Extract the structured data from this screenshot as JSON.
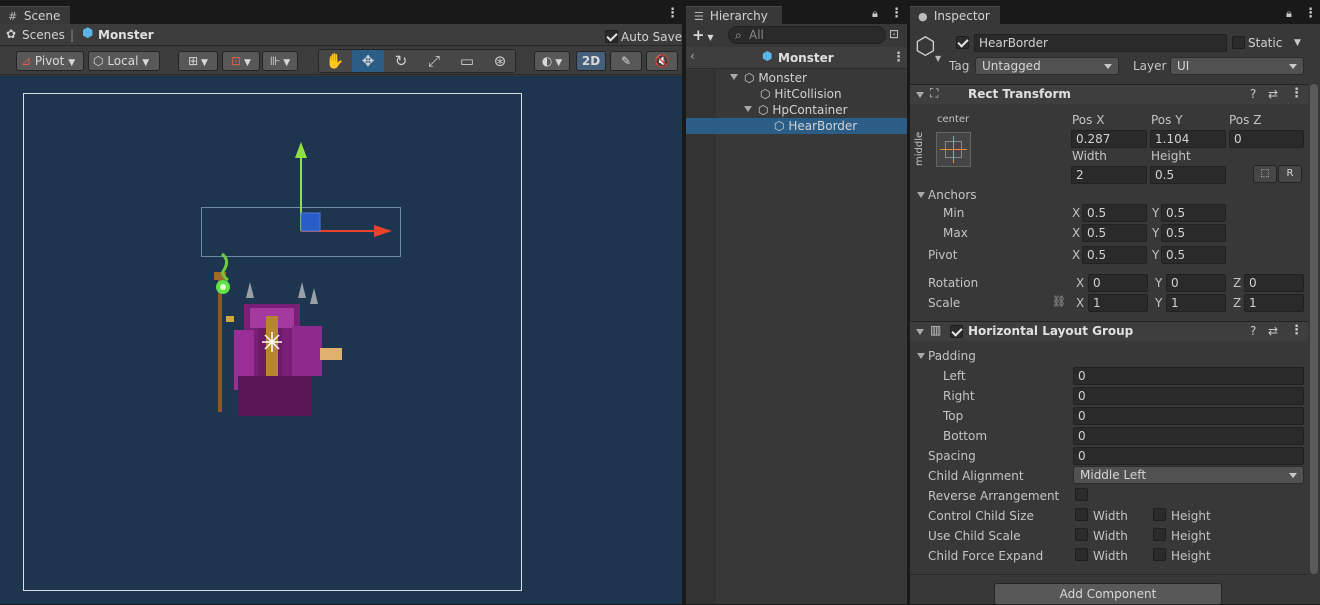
{
  "scene": {
    "tab_title": "Scene",
    "breadcrumb_root": "Scenes",
    "breadcrumb_current": "Monster",
    "auto_save_label": "Auto Save",
    "auto_save_checked": true,
    "pivot_label": "Pivot",
    "local_label": "Local",
    "mode_2d_label": "2D"
  },
  "hierarchy": {
    "tab_title": "Hierarchy",
    "search_placeholder": "All",
    "scene_root": "Monster",
    "items": [
      {
        "label": "Monster"
      },
      {
        "label": "HitCollision"
      },
      {
        "label": "HpContainer"
      },
      {
        "label": "HearBorder"
      }
    ]
  },
  "inspector": {
    "tab_title": "Inspector",
    "object_name": "HearBorder",
    "static_label": "Static",
    "tag_label": "Tag",
    "tag_value": "Untagged",
    "layer_label": "Layer",
    "layer_value": "UI",
    "rect_transform": {
      "title": "Rect Transform",
      "anchor_h": "center",
      "anchor_v": "middle",
      "pos_x_label": "Pos X",
      "pos_x": "0.287",
      "pos_y_label": "Pos Y",
      "pos_y": "1.104",
      "pos_z_label": "Pos Z",
      "pos_z": "0",
      "width_label": "Width",
      "width": "2",
      "height_label": "Height",
      "height": "0.5",
      "r_button": "R",
      "anchors_label": "Anchors",
      "min_label": "Min",
      "min_x": "0.5",
      "min_y": "0.5",
      "max_label": "Max",
      "max_x": "0.5",
      "max_y": "0.5",
      "pivot_label": "Pivot",
      "pivot_x": "0.5",
      "pivot_y": "0.5",
      "rotation_label": "Rotation",
      "rot_x": "0",
      "rot_y": "0",
      "rot_z": "0",
      "scale_label": "Scale",
      "scale_x": "1",
      "scale_y": "1",
      "scale_z": "1",
      "x": "X",
      "y": "Y",
      "z": "Z"
    },
    "hlg": {
      "title": "Horizontal Layout Group",
      "padding_label": "Padding",
      "left_label": "Left",
      "left": "0",
      "right_label": "Right",
      "right": "0",
      "top_label": "Top",
      "top": "0",
      "bottom_label": "Bottom",
      "bottom": "0",
      "spacing_label": "Spacing",
      "spacing": "0",
      "child_alignment_label": "Child Alignment",
      "child_alignment": "Middle Left",
      "reverse_label": "Reverse Arrangement",
      "control_size_label": "Control Child Size",
      "use_scale_label": "Use Child Scale",
      "force_expand_label": "Child Force Expand",
      "width_label": "Width",
      "height_label": "Height"
    },
    "add_component": "Add Component"
  },
  "colors": {
    "scene_bg": "#1e3550",
    "selection": "#2c5d87",
    "accent_2d": "#46607c"
  }
}
